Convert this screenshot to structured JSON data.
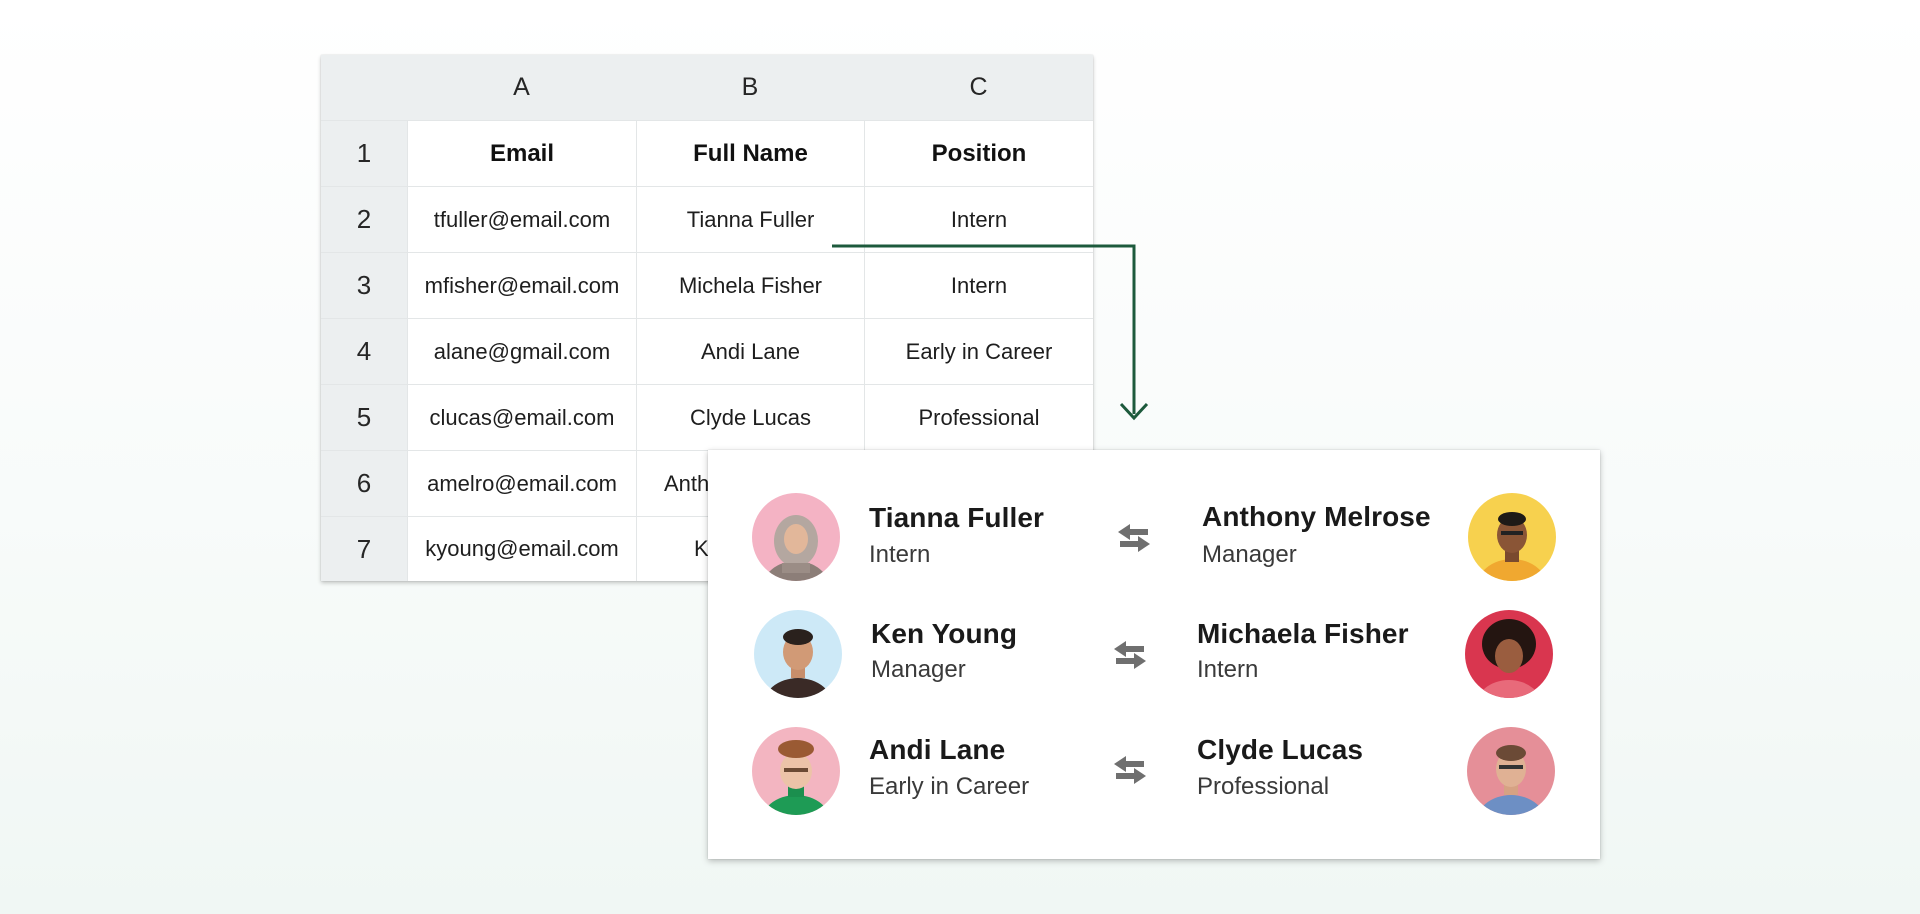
{
  "sheet": {
    "columns": [
      "A",
      "B",
      "C"
    ],
    "rows": [
      {
        "num": "1",
        "cells": [
          "Email",
          "Full Name",
          "Position"
        ]
      },
      {
        "num": "2",
        "cells": [
          "tfuller@email.com",
          "Tianna Fuller",
          "Intern"
        ]
      },
      {
        "num": "3",
        "cells": [
          "mfisher@email.com",
          "Michela Fisher",
          "Intern"
        ]
      },
      {
        "num": "4",
        "cells": [
          "alane@gmail.com",
          "Andi Lane",
          "Early in Career"
        ]
      },
      {
        "num": "5",
        "cells": [
          "clucas@email.com",
          "Clyde Lucas",
          "Professional"
        ]
      },
      {
        "num": "6",
        "cells": [
          "amelro@email.com",
          "Anth",
          ""
        ]
      },
      {
        "num": "7",
        "cells": [
          "kyoung@email.com",
          "K",
          ""
        ]
      }
    ]
  },
  "matches": [
    {
      "left": {
        "name": "Tianna Fuller",
        "role": "Intern"
      },
      "right": {
        "name": "Anthony Melrose",
        "role": "Manager"
      }
    },
    {
      "left": {
        "name": "Ken Young",
        "role": "Manager"
      },
      "right": {
        "name": "Michaela Fisher",
        "role": "Intern"
      }
    },
    {
      "left": {
        "name": "Andi Lane",
        "role": "Early in Career"
      },
      "right": {
        "name": "Clyde Lucas",
        "role": "Professional"
      }
    }
  ],
  "icons": {
    "swap": "swap-arrows-icon",
    "connector": "arrow-down-icon"
  },
  "colors": {
    "connector": "#1d5a3c",
    "swap_icon": "#6f6f6f"
  }
}
